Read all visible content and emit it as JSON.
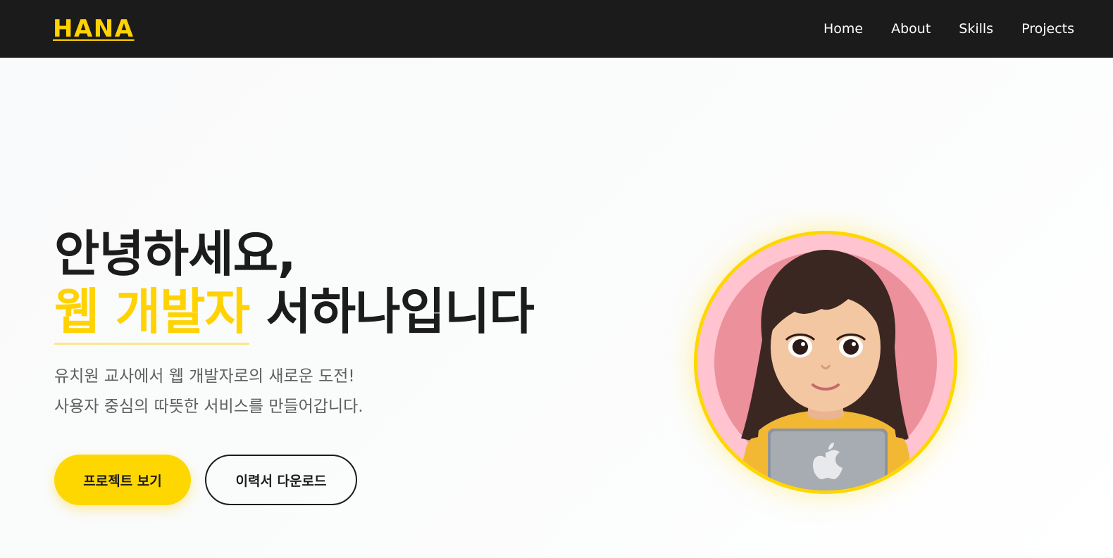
{
  "nav": {
    "logo": "HANA",
    "links": [
      "Home",
      "About",
      "Skills",
      "Projects"
    ]
  },
  "hero": {
    "greeting": "안녕하세요,",
    "highlight": "웹 개발자",
    "name_suffix": "서하나입니다",
    "description": [
      "유치원 교사에서 웹 개발자로의 새로운 도전!",
      "사용자 중심의 따뜻한 서비스를 만들어갑니다."
    ],
    "primary_button": "프로젝트 보기",
    "secondary_button": "이력서 다운로드"
  },
  "colors": {
    "accent": "#ffd700",
    "navbar": "#1b1b1b",
    "text": "#1c1c1c",
    "avatar_bg": "#ffc4cf"
  },
  "icons": {
    "avatar": "memoji-avatar-icon",
    "laptop": "laptop-apple-logo-icon"
  }
}
